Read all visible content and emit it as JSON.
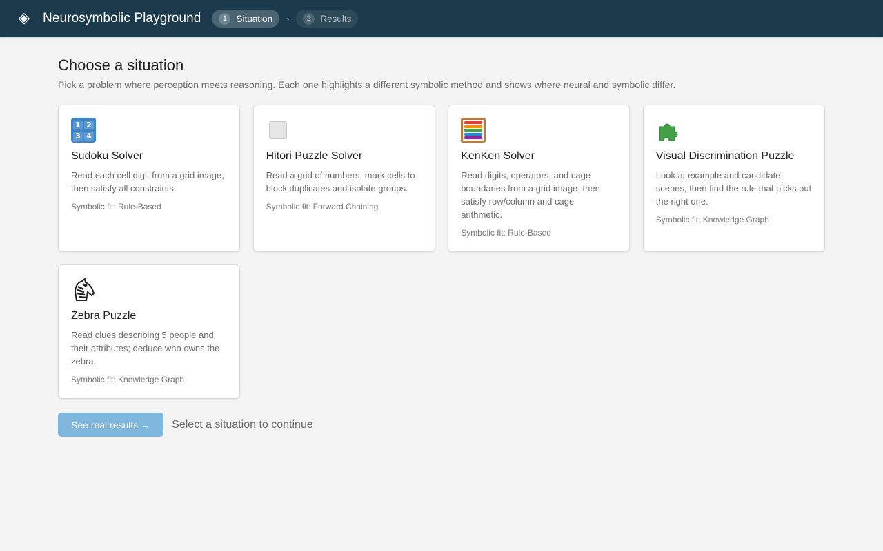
{
  "header": {
    "logo_icon": "diamond-logo-icon",
    "title": "Neurosymbolic Playground",
    "steps": [
      {
        "number": "1",
        "label": "Situation",
        "active": true
      },
      {
        "number": "2",
        "label": "Results",
        "active": false
      }
    ],
    "separator": "›",
    "colors": {
      "bar": "#1b3a4b",
      "active_step": "#4a6474"
    }
  },
  "main": {
    "title": "Choose a situation",
    "subtitle": "Pick a problem where perception meets reasoning. Each one highlights a different symbolic method and shows where neural and symbolic differ.",
    "cards": [
      {
        "icon": "sudoku-grid-icon",
        "icon_digits": [
          "1",
          "2",
          "3",
          "4"
        ],
        "title": "Sudoku Solver",
        "description": "Read each cell digit from a grid image, then satisfy all constraints.",
        "fit": "Symbolic fit: Rule-Based"
      },
      {
        "icon": "blank-square-icon",
        "title": "Hitori Puzzle Solver",
        "description": "Read a grid of numbers, mark cells to block duplicates and isolate groups.",
        "fit": "Symbolic fit: Forward Chaining"
      },
      {
        "icon": "abacus-icon",
        "title": "KenKen Solver",
        "description": "Read digits, operators, and cage boundaries from a grid image, then satisfy row/column and cage arithmetic.",
        "fit": "Symbolic fit: Rule-Based"
      },
      {
        "icon": "puzzle-piece-icon",
        "title": "Visual Discrimination Puzzle",
        "description": "Look at example and candidate scenes, then find the rule that picks out the right one.",
        "fit": "Symbolic fit: Knowledge Graph"
      },
      {
        "icon": "zebra-icon",
        "title": "Zebra Puzzle",
        "description": "Read clues describing 5 people and their attributes; deduce who owns the zebra.",
        "fit": "Symbolic fit: Knowledge Graph"
      }
    ]
  },
  "footer": {
    "button_label": "See real results →",
    "button_disabled": true,
    "hint": "Select a situation to continue",
    "colors": {
      "button": "#7fb6dd"
    }
  }
}
